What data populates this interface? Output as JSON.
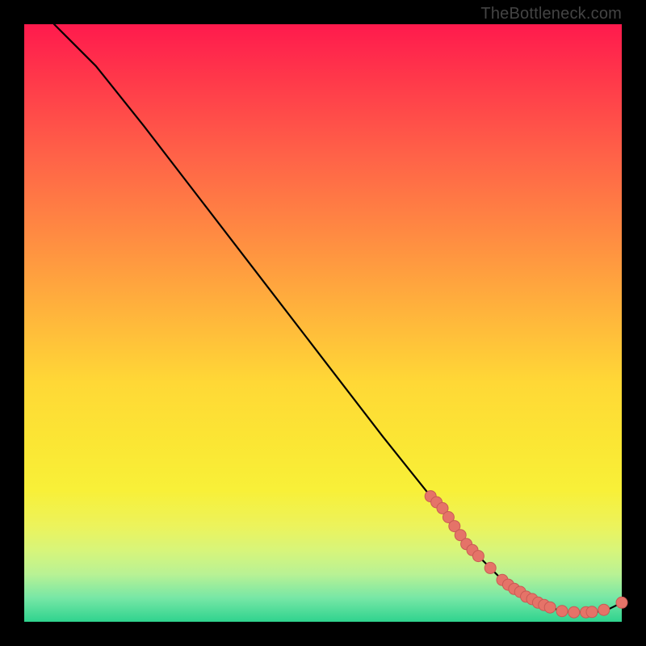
{
  "attribution": "TheBottleneck.com",
  "colors": {
    "bg": "#000000",
    "gradient_top": "#ff1a4d",
    "gradient_mid": "#ffd836",
    "gradient_bottom": "#2fd38e",
    "curve": "#000000",
    "dot_fill": "#e57368",
    "dot_stroke": "#c95a55"
  },
  "chart_data": {
    "type": "line",
    "title": "",
    "xlabel": "",
    "ylabel": "",
    "xlim": [
      0,
      100
    ],
    "ylim": [
      0,
      100
    ],
    "grid": false,
    "legend": false,
    "series": [
      {
        "name": "bottleneck-curve",
        "x": [
          5,
          8,
          12,
          20,
          30,
          40,
          50,
          60,
          68,
          72,
          75,
          78,
          80,
          82,
          84,
          86,
          88,
          90,
          92,
          94,
          96,
          98,
          100
        ],
        "y": [
          100,
          97,
          93,
          83,
          70,
          57,
          44,
          31,
          21,
          16,
          12,
          9,
          7,
          5.5,
          4.2,
          3.2,
          2.4,
          1.8,
          1.6,
          1.6,
          1.7,
          2.2,
          3.2
        ]
      }
    ],
    "highlight_points": {
      "name": "highlight-dots",
      "x": [
        68,
        69,
        70,
        71,
        72,
        73,
        74,
        75,
        76,
        78,
        80,
        81,
        82,
        83,
        84,
        85,
        86,
        87,
        88,
        90,
        92,
        94,
        95,
        97,
        100
      ],
      "y": [
        21,
        20,
        19,
        17.5,
        16,
        14.5,
        13,
        12,
        11,
        9,
        7,
        6.2,
        5.5,
        5.0,
        4.2,
        3.8,
        3.2,
        2.8,
        2.4,
        1.8,
        1.6,
        1.6,
        1.65,
        2.0,
        3.2
      ]
    }
  }
}
